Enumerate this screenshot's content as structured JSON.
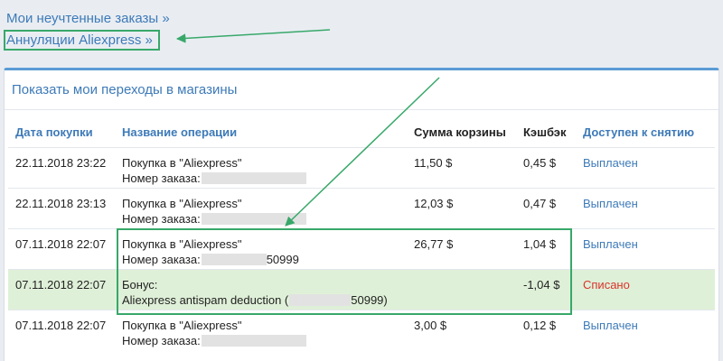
{
  "top_links": [
    {
      "label": "Мои неучтенные заказы »"
    },
    {
      "label": "Аннуляции Aliexpress »"
    }
  ],
  "panel": {
    "title": "Показать мои переходы в магазины"
  },
  "table": {
    "headers": [
      "Дата покупки",
      "Название операции",
      "Сумма корзины",
      "Кэшбэк",
      "Доступен к снятию"
    ],
    "rows": [
      {
        "date": "22.11.2018 23:22",
        "op_line1": "Покупка в \"Aliexpress\"",
        "op_line2_prefix": "Номер заказа:",
        "op_line2_suffix": "",
        "sum": "11,50 $",
        "cashback": "0,45 $",
        "status": "Выплачен"
      },
      {
        "date": "22.11.2018 23:13",
        "op_line1": "Покупка в \"Aliexpress\"",
        "op_line2_prefix": "Номер заказа:",
        "op_line2_suffix": "",
        "sum": "12,03 $",
        "cashback": "0,47 $",
        "status": "Выплачен"
      },
      {
        "date": "07.11.2018 22:07",
        "op_line1": "Покупка в \"Aliexpress\"",
        "op_line2_prefix": "Номер заказа:",
        "op_line2_suffix": "50999",
        "sum": "26,77 $",
        "cashback": "1,04 $",
        "status": "Выплачен"
      },
      {
        "date": "07.11.2018 22:07",
        "op_line1": "Бонус:",
        "op_line2_prefix": "Aliexpress antispam deduction (",
        "op_line2_suffix": "50999)",
        "sum": "",
        "cashback": "-1,04 $",
        "status": "Списано"
      },
      {
        "date": "07.11.2018 22:07",
        "op_line1": "Покупка в \"Aliexpress\"",
        "op_line2_prefix": "Номер заказа:",
        "op_line2_suffix": "",
        "sum": "3,00 $",
        "cashback": "0,12 $",
        "status": "Выплачен"
      }
    ]
  },
  "colors": {
    "link": "#3d7ab8",
    "annotation": "#38a86a",
    "bonus_row": "#dff0d8",
    "written_off": "#d9342b"
  }
}
